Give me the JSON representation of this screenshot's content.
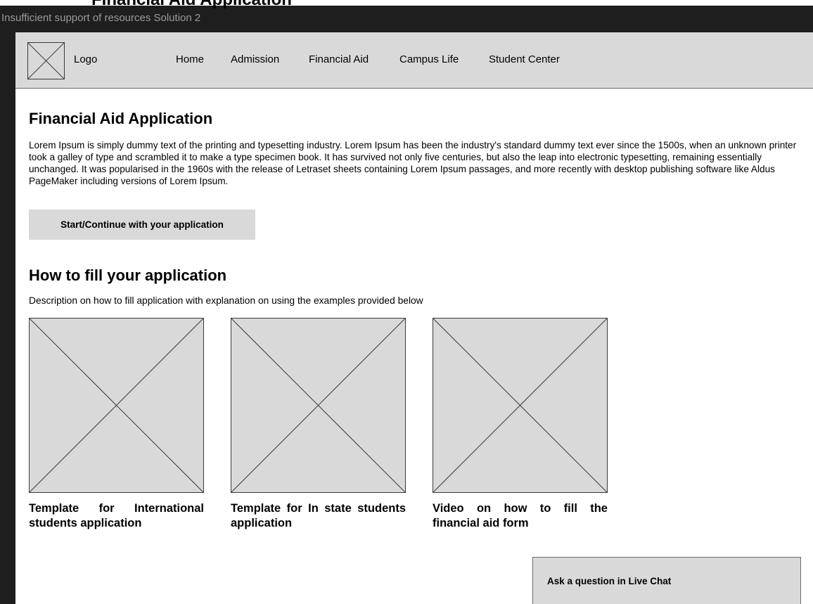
{
  "canvas": {
    "frame_label": "Insufficient support of resources Solution 2",
    "partial_frame_heading": "Financial Aid Application"
  },
  "navbar": {
    "logo_label": "Logo",
    "items": [
      "Home",
      "Admission",
      "Financial Aid",
      "Campus Life",
      "Student Center"
    ]
  },
  "application": {
    "title": "Financial Aid Application",
    "intro": "Lorem Ipsum is simply dummy text of the printing and typesetting industry. Lorem Ipsum has been the industry's standard dummy text ever since the 1500s, when an unknown printer took a galley of type and scrambled it to make a type specimen book. It has survived not only five centuries, but also the leap into electronic typesetting, remaining essentially unchanged. It was popularised in the 1960s with the release of Letraset sheets containing Lorem Ipsum passages, and more recently with desktop publishing software like Aldus PageMaker including versions of Lorem Ipsum.",
    "cta_label": "Start/Continue with your application"
  },
  "howto": {
    "title": "How to fill your application",
    "description": "Description on how to fill application with explanation on using the examples provided below",
    "cards": [
      {
        "caption": "Template for International students application",
        "icon": "image-placeholder-icon"
      },
      {
        "caption": "Template for In state students application",
        "icon": "image-placeholder-icon"
      },
      {
        "caption": "Video on how to fill the financial aid form",
        "icon": "video-placeholder-icon"
      }
    ]
  },
  "live_chat": {
    "label": "Ask a question in Live Chat"
  },
  "colors": {
    "canvas_bg": "#1e1e1e",
    "frame_bg": "#ffffff",
    "placeholder_fill": "#d9d9d9",
    "placeholder_stroke": "#3a3a3a",
    "frame_label_text": "#9a9a9a"
  }
}
